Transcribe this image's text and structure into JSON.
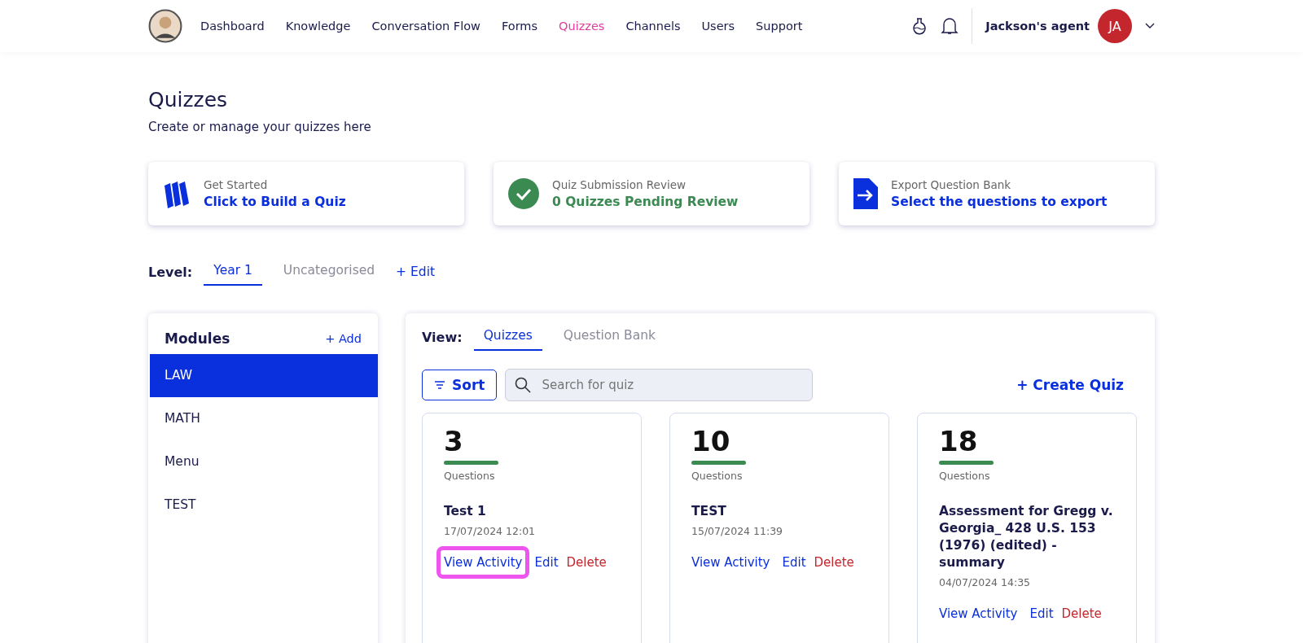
{
  "nav": {
    "items": [
      {
        "label": "Dashboard",
        "selected": false
      },
      {
        "label": "Knowledge",
        "selected": false
      },
      {
        "label": "Conversation Flow",
        "selected": false
      },
      {
        "label": "Forms",
        "selected": false
      },
      {
        "label": "Quizzes",
        "selected": true
      },
      {
        "label": "Channels",
        "selected": false
      },
      {
        "label": "Users",
        "selected": false
      },
      {
        "label": "Support",
        "selected": false
      }
    ],
    "account_name": "Jackson's agent",
    "avatar_initials": "JA"
  },
  "page": {
    "title": "Quizzes",
    "subtitle": "Create or manage your quizzes here"
  },
  "shortcuts": [
    {
      "kind": "books",
      "label": "Get Started",
      "action": "Click to Build a Quiz"
    },
    {
      "kind": "check",
      "label": "Quiz Submission Review",
      "action": "0 Quizzes Pending Review"
    },
    {
      "kind": "export",
      "label": "Export Question Bank",
      "action": "Select the questions to export"
    }
  ],
  "level": {
    "label": "Level:",
    "tabs": [
      {
        "label": "Year 1",
        "selected": true
      },
      {
        "label": "Uncategorised",
        "selected": false
      }
    ],
    "edit": "+ Edit"
  },
  "modules": {
    "title": "Modules",
    "add": "+ Add",
    "items": [
      {
        "label": "LAW",
        "selected": true
      },
      {
        "label": "MATH",
        "selected": false
      },
      {
        "label": "Menu",
        "selected": false
      },
      {
        "label": "TEST",
        "selected": false
      }
    ]
  },
  "view": {
    "label": "View:",
    "tabs": [
      {
        "label": "Quizzes",
        "selected": true
      },
      {
        "label": "Question Bank",
        "selected": false
      }
    ],
    "sort": "Sort",
    "search": {
      "placeholder": "Search for quiz"
    },
    "create": "+ Create Quiz"
  },
  "quizzes": [
    {
      "count": "3",
      "count_label": "Questions",
      "title": "Test 1",
      "date": "17/07/2024 12:01",
      "actions": {
        "view": "View Activity",
        "edit": "Edit",
        "delete": "Delete"
      },
      "highlighted": true
    },
    {
      "count": "10",
      "count_label": "Questions",
      "title": "TEST",
      "date": "15/07/2024 11:39",
      "actions": {
        "view": "View Activity",
        "edit": "Edit",
        "delete": "Delete"
      },
      "highlighted": false
    },
    {
      "count": "18",
      "count_label": "Questions",
      "title": "Assessment for Gregg v. Georgia_ 428 U.S. 153 (1976) (edited) - summary",
      "date": "04/07/2024 14:35",
      "actions": {
        "view": "View Activity",
        "edit": "Edit",
        "delete": "Delete"
      },
      "highlighted": false
    }
  ]
}
